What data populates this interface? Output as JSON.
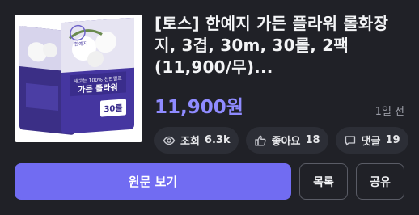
{
  "product": {
    "title": "[토스] 한예지 가든 플라워 롤화장지, 3겹, 30m, 30롤, 2팩(11,900/무)...",
    "price": "11,900원",
    "posted": "1일 전",
    "image_alt": "Product image: boxed toilet paper packs",
    "box_brand": "한예지",
    "box_tagline": "새고는 100% 천연펄프",
    "box_name": "가든 플라워",
    "box_count": "30롤"
  },
  "stats": {
    "views_label": "조회",
    "views_value": "6.3k",
    "likes_label": "좋아요",
    "likes_value": "18",
    "comments_label": "댓글",
    "comments_value": "19"
  },
  "actions": {
    "view_original": "원문 보기",
    "list": "목록",
    "share": "공유"
  },
  "colors": {
    "background": "#202127",
    "accent": "#716cf2",
    "price": "#8f8bff",
    "chip_bg": "#2c2e36"
  },
  "icons": [
    "eye-icon",
    "thumbs-up-icon",
    "comment-icon"
  ]
}
